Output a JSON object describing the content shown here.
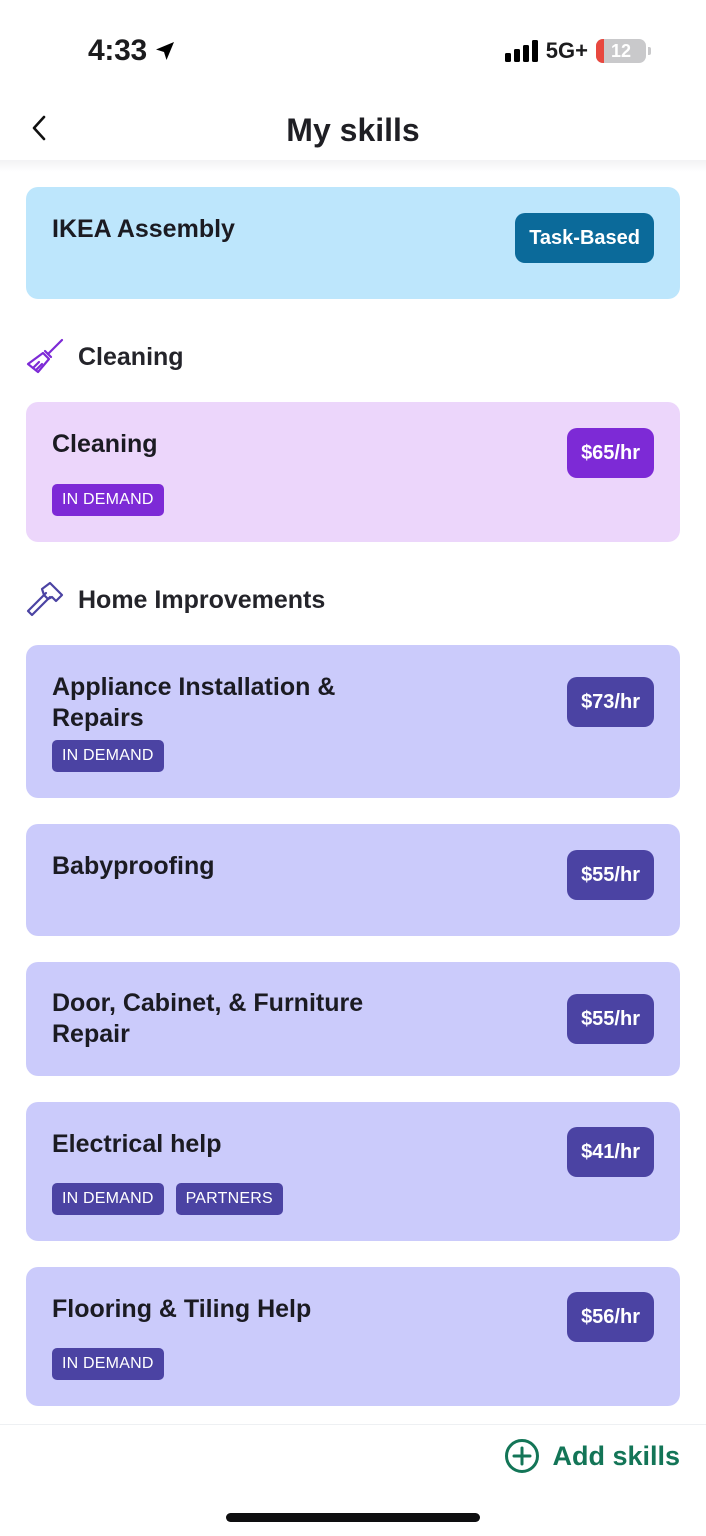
{
  "status_bar": {
    "time": "4:33",
    "network": "5G+",
    "battery": "12"
  },
  "header": {
    "title": "My skills",
    "back_icon": "chevron-left-icon"
  },
  "featured": {
    "title": "IKEA Assembly",
    "badge": "Task-Based"
  },
  "sections": [
    {
      "name": "Cleaning",
      "icon": "broom-icon",
      "skills": [
        {
          "title": "Cleaning",
          "price": "$65/hr",
          "tags": [
            "IN DEMAND"
          ]
        }
      ]
    },
    {
      "name": "Home Improvements",
      "icon": "hammer-icon",
      "skills": [
        {
          "title_line1": "Appliance Installation &",
          "title_line2": "Repairs",
          "price": "$73/hr",
          "tags": [
            "IN DEMAND"
          ]
        },
        {
          "title": "Babyproofing",
          "price": "$55/hr",
          "tags": []
        },
        {
          "title_line1": "Door, Cabinet, & Furniture",
          "title_line2": "Repair",
          "price": "$55/hr",
          "tags": []
        },
        {
          "title": "Electrical help",
          "price": "$41/hr",
          "tags": [
            "IN DEMAND",
            "PARTNERS"
          ]
        },
        {
          "title": "Flooring & Tiling Help",
          "price": "$56/hr",
          "tags": [
            "IN DEMAND"
          ]
        }
      ]
    }
  ],
  "footer": {
    "add_label": "Add skills",
    "add_icon": "plus-circle-icon"
  },
  "colors": {
    "ikea_card": "#bde6fc",
    "cleaning_card": "#ecd6fb",
    "home_card": "#cbcbfb",
    "task_badge": "#0b6a9a",
    "cleaning_accent": "#7d2ad6",
    "home_accent": "#4b43a3",
    "add_skills": "#137557"
  }
}
